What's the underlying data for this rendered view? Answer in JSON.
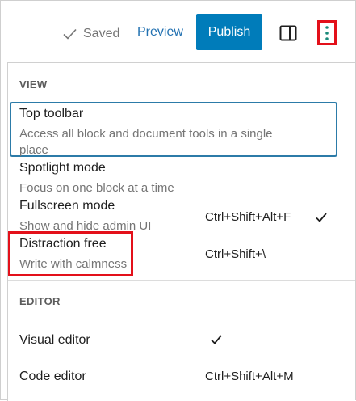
{
  "toolbar": {
    "saved_label": "Saved",
    "preview_label": "Preview",
    "publish_label": "Publish",
    "icons": {
      "saved": "check-icon",
      "settings": "sidebar-toggle-icon",
      "options": "vertical-ellipsis-icon"
    }
  },
  "menu": {
    "view_section": {
      "title": "VIEW",
      "items": [
        {
          "label": "Top toolbar",
          "description_line1": "Access all block and document tools in a single",
          "description_line2": "place",
          "shortcut": "",
          "checked": false
        },
        {
          "label": "Spotlight mode",
          "description": "Focus on one block at a time",
          "shortcut": "",
          "checked": false
        },
        {
          "label": "Fullscreen mode",
          "description": "Show and hide admin UI",
          "shortcut": "Ctrl+Shift+Alt+F",
          "checked": true
        },
        {
          "label": "Distraction free",
          "description": "Write with calmness",
          "shortcut": "Ctrl+Shift+\\",
          "checked": false
        }
      ]
    },
    "editor_section": {
      "title": "EDITOR",
      "items": [
        {
          "label": "Visual editor",
          "shortcut": "",
          "checked": true
        },
        {
          "label": "Code editor",
          "shortcut": "Ctrl+Shift+Alt+M",
          "checked": false
        }
      ]
    }
  },
  "colors": {
    "accent": "#007cba",
    "link": "#2271b1",
    "highlight": "#e3101a",
    "focus": "#2c7ba8"
  }
}
